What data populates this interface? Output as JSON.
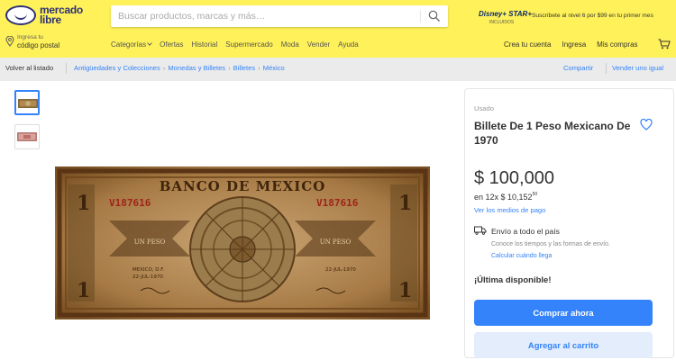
{
  "header": {
    "logo_line1": "mercado",
    "logo_line2": "libre",
    "search_placeholder": "Buscar productos, marcas y más…",
    "promo_brand": "Disney+ STAR+",
    "promo_brand_sub": "INCLUIDOS",
    "promo_text": "Suscríbete al nivel 6 por $99 en tu primer mes",
    "location_line1": "Ingresa tu",
    "location_line2": "código postal",
    "nav": [
      "Categorías",
      "Ofertas",
      "Historial",
      "Supermercado",
      "Moda",
      "Vender",
      "Ayuda"
    ],
    "user_nav": [
      "Crea tu cuenta",
      "Ingresa",
      "Mis compras"
    ],
    "colors": {
      "brand_yellow": "#fff159",
      "logo_blue": "#2d3277"
    }
  },
  "breadcrumb": {
    "back_label": "Volver al listado",
    "items": [
      "Antigüedades y Colecciones",
      "Monedas y Billetes",
      "Billetes",
      "México"
    ],
    "share_label": "Compartir",
    "sell_label": "Vender uno igual"
  },
  "gallery": {
    "thumbnails": [
      "bill-front-thumbnail",
      "bill-back-thumbnail"
    ],
    "bill": {
      "bank": "BANCO DE MEXICO",
      "serial": "V187616",
      "denomination": "1",
      "words": "UN PESO",
      "place": "MEXICO, D.F.",
      "date": "22-JUL-1970"
    }
  },
  "product": {
    "condition": "Usado",
    "title": "Billete De 1 Peso Mexicano De 1970",
    "price": "$ 100,000",
    "installments_prefix": "en 12x $ 10,152",
    "installments_cents": "50",
    "payment_link": "Ver los medios de pago",
    "shipping_title": "Envío a todo el país",
    "shipping_sub": "Conoce los tiempos y las formas de envío.",
    "shipping_link": "Calcular cuándo llega",
    "stock": "¡Última disponible!",
    "buy_label": "Comprar ahora",
    "cart_label": "Agregar al carrito"
  },
  "colors": {
    "accent": "#3483fa",
    "accent_light": "#e3edfb"
  }
}
